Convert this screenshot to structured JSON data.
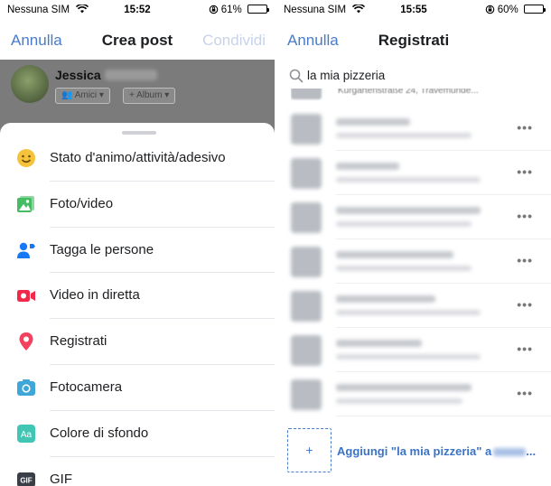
{
  "left_screen": {
    "status_bar": {
      "carrier": "Nessuna SIM",
      "time": "15:52",
      "battery": "61%",
      "battery_level": 0.61
    },
    "nav": {
      "cancel_label": "Annulla",
      "title": "Crea post",
      "share_label": "Condividi"
    },
    "composer": {
      "author_name": "Jessica",
      "audience_label": "Amici",
      "album_label": "Album"
    },
    "menu_items": [
      {
        "label": "Stato d'animo/attività/adesivo",
        "icon": "emoji-smile-icon",
        "color": "#f5c33b"
      },
      {
        "label": "Foto/video",
        "icon": "photo-icon",
        "color": "#45bd62"
      },
      {
        "label": "Tagga le persone",
        "icon": "tag-people-icon",
        "color": "#1877f2"
      },
      {
        "label": "Video in diretta",
        "icon": "live-video-icon",
        "color": "#f02849"
      },
      {
        "label": "Registrati",
        "icon": "location-pin-icon",
        "color": "#f3425f"
      },
      {
        "label": "Fotocamera",
        "icon": "camera-icon",
        "color": "#3ea6d8"
      },
      {
        "label": "Colore di sfondo",
        "icon": "background-color-icon",
        "color": "#42c6b4"
      },
      {
        "label": "GIF",
        "icon": "gif-icon",
        "color": "#3a3f47"
      }
    ]
  },
  "right_screen": {
    "status_bar": {
      "carrier": "Nessuna SIM",
      "time": "15:55",
      "battery": "60%",
      "battery_level": 0.6
    },
    "nav": {
      "cancel_label": "Annulla",
      "title": "Registrati"
    },
    "search": {
      "value": "la mia pizzeria"
    },
    "peek_address": "Kurgartenstraße 24, Travemünde...",
    "result_more_label": "•••",
    "add_place": {
      "label": "Aggiungi \"la mia pizzeria\" a",
      "plus": "+",
      "ellipsis": "..."
    }
  },
  "colors": {
    "accent_blue": "#4a7bc8",
    "disabled_blue": "#c8d3e8",
    "dim_overlay": "#7b7b7b"
  }
}
